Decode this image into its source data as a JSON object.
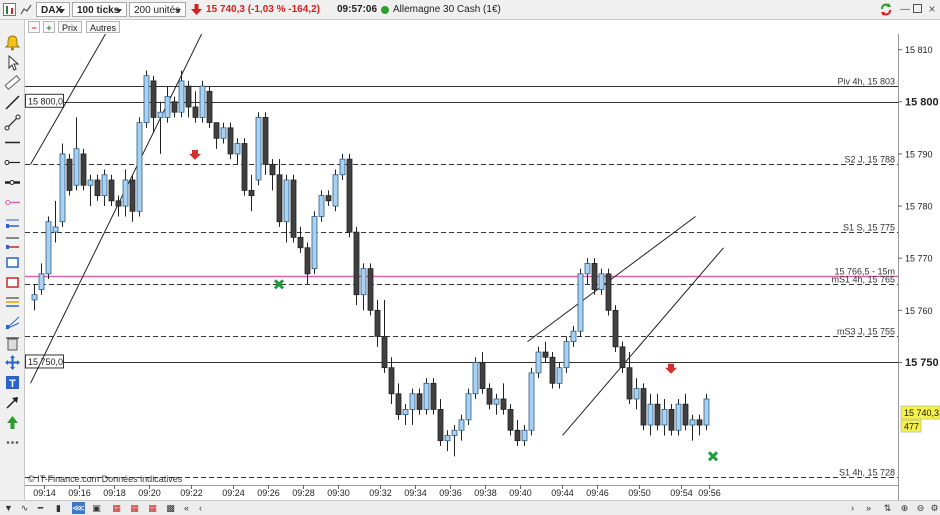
{
  "toolbar": {
    "instrument": "DAX",
    "period": "100 ticks",
    "units": "200 unités",
    "price_text": "15 740,3 (-1,03 % -164,2)",
    "time": "09:57:06",
    "market_name": "Allemagne 30 Cash (1€)",
    "price_color": "#d42020",
    "status_color": "#2aa02a"
  },
  "subbar": {
    "prix": "Prix",
    "autres": "Autres"
  },
  "watermark": "© IT-Finance.com Données indicatives",
  "tools": [
    "alert-bell-icon",
    "pointer-icon",
    "ruler-icon",
    "trendline-icon",
    "segment-icon",
    "horizontal-line-icon",
    "ray-icon",
    "thick-line-icon",
    "pink-line-icon",
    "channel-icon",
    "retracement-icon",
    "box-icon",
    "red-box-icon",
    "fibonacci-icon",
    "fan-icon",
    "trash-icon",
    "move-icon",
    "text-icon",
    "arrow-icon",
    "green-arrow-icon",
    "more-icon"
  ],
  "chart_data": {
    "type": "candlestick",
    "y_range": [
      15726.5,
      15813
    ],
    "y_ticks": [
      {
        "value": 15810,
        "label": "15 810",
        "bold": false
      },
      {
        "value": 15800,
        "label": "15 800",
        "bold": true
      },
      {
        "value": 15790,
        "label": "15 790",
        "bold": false
      },
      {
        "value": 15780,
        "label": "15 780",
        "bold": false
      },
      {
        "value": 15770,
        "label": "15 770",
        "bold": false
      },
      {
        "value": 15760,
        "label": "15 760",
        "bold": false
      },
      {
        "value": 15750,
        "label": "15 750",
        "bold": true
      }
    ],
    "x_ticks": [
      {
        "index": 1.5,
        "label": "09:14"
      },
      {
        "index": 6.5,
        "label": "09:16"
      },
      {
        "index": 11.5,
        "label": "09:18"
      },
      {
        "index": 16.5,
        "label": "09:20"
      },
      {
        "index": 22.5,
        "label": "09:22"
      },
      {
        "index": 28.5,
        "label": "09:24"
      },
      {
        "index": 33.5,
        "label": "09:26"
      },
      {
        "index": 38.5,
        "label": "09:28"
      },
      {
        "index": 43.5,
        "label": "09:30"
      },
      {
        "index": 49.5,
        "label": "09:32"
      },
      {
        "index": 54.5,
        "label": "09:34"
      },
      {
        "index": 59.5,
        "label": "09:36"
      },
      {
        "index": 64.5,
        "label": "09:38"
      },
      {
        "index": 69.5,
        "label": "09:40"
      },
      {
        "index": 75.5,
        "label": "09:44"
      },
      {
        "index": 80.5,
        "label": "09:46"
      },
      {
        "index": 86.5,
        "label": "09:50"
      },
      {
        "index": 92.5,
        "label": "09:54"
      },
      {
        "index": 96.5,
        "label": "09:56"
      }
    ],
    "levels": [
      {
        "value": 15803,
        "label": "Piv 4h, 15 803",
        "style": "solid",
        "color": "#333333"
      },
      {
        "value": 15800,
        "label": "",
        "style": "solid",
        "color": "#333333"
      },
      {
        "value": 15788,
        "label": "S2 J, 15 788",
        "style": "dashed",
        "color": "#333333"
      },
      {
        "value": 15775,
        "label": "S1 S, 15 775",
        "style": "dashed",
        "color": "#333333"
      },
      {
        "value": 15766.5,
        "label": "15 766,5 - 15m",
        "style": "solid",
        "color": "#e060b0"
      },
      {
        "value": 15765,
        "label": "mS1 4h, 15 765",
        "style": "dashed",
        "color": "#333333"
      },
      {
        "value": 15755,
        "label": "mS3 J, 15 755",
        "style": "dashed",
        "color": "#333333"
      },
      {
        "value": 15750,
        "label": "",
        "style": "solid",
        "color": "#333333"
      },
      {
        "value": 15728,
        "label": "S1 4h, 15 728",
        "style": "dashed",
        "color": "#333333"
      }
    ],
    "boxed_labels": [
      {
        "value": 15800,
        "label": "15 800,0"
      },
      {
        "value": 15750,
        "label": "15 750,0"
      }
    ],
    "last_price": {
      "value": 15740.3,
      "label": "15 740,3",
      "volume": "477"
    },
    "candles": [
      [
        15762,
        15765,
        15760,
        15763
      ],
      [
        15764,
        15769,
        15763,
        15767
      ],
      [
        15767,
        15778,
        15766,
        15777
      ],
      [
        15775,
        15781,
        15773,
        15776
      ],
      [
        15777,
        15792,
        15776,
        15790
      ],
      [
        15789,
        15790,
        15782,
        15783
      ],
      [
        15784,
        15797,
        15783,
        15791
      ],
      [
        15790,
        15791,
        15783,
        15784
      ],
      [
        15784,
        15786,
        15780,
        15785
      ],
      [
        15785,
        15786,
        15781,
        15782
      ],
      [
        15782,
        15787,
        15780,
        15786
      ],
      [
        15785,
        15786,
        15780,
        15781
      ],
      [
        15781,
        15782,
        15778,
        15780
      ],
      [
        15780,
        15787,
        15778,
        15785
      ],
      [
        15785,
        15786,
        15777,
        15779
      ],
      [
        15779,
        15797,
        15778,
        15796
      ],
      [
        15796,
        15806,
        15795,
        15805
      ],
      [
        15804,
        15805,
        15794,
        15797
      ],
      [
        15797,
        15800,
        15790,
        15798
      ],
      [
        15797,
        15803,
        15796,
        15801
      ],
      [
        15800,
        15801,
        15797,
        15798
      ],
      [
        15798,
        15806,
        15797,
        15804
      ],
      [
        15803,
        15804,
        15797,
        15799
      ],
      [
        15799,
        15802,
        15796,
        15797
      ],
      [
        15797,
        15804,
        15796,
        15803
      ],
      [
        15802,
        15803,
        15795,
        15796
      ],
      [
        15796,
        15796,
        15791,
        15793
      ],
      [
        15793,
        15796,
        15792,
        15795
      ],
      [
        15795,
        15796,
        15789,
        15790
      ],
      [
        15790,
        15793,
        15788,
        15792
      ],
      [
        15792,
        15793,
        15782,
        15783
      ],
      [
        15783,
        15786,
        15779,
        15782
      ],
      [
        15785,
        15798,
        15784,
        15797
      ],
      [
        15797,
        15798,
        15786,
        15788
      ],
      [
        15788,
        15789,
        15783,
        15786
      ],
      [
        15786,
        15789,
        15776,
        15777
      ],
      [
        15777,
        15786,
        15773,
        15785
      ],
      [
        15785,
        15786,
        15773,
        15774
      ],
      [
        15774,
        15776,
        15771,
        15772
      ],
      [
        15772,
        15773,
        15765,
        15767
      ],
      [
        15768,
        15779,
        15767,
        15778
      ],
      [
        15778,
        15783,
        15777,
        15782
      ],
      [
        15782,
        15783,
        15780,
        15781
      ],
      [
        15780,
        15787,
        15779,
        15786
      ],
      [
        15786,
        15790,
        15785,
        15789
      ],
      [
        15789,
        15790,
        15774,
        15775
      ],
      [
        15775,
        15776,
        15761,
        15763
      ],
      [
        15763,
        15769,
        15760,
        15768
      ],
      [
        15768,
        15769,
        15759,
        15760
      ],
      [
        15760,
        15762,
        15753,
        15755
      ],
      [
        15755,
        15762,
        15748,
        15749
      ],
      [
        15749,
        15751,
        15742,
        15744
      ],
      [
        15744,
        15746,
        15739,
        15740
      ],
      [
        15740,
        15742,
        15738,
        15741
      ],
      [
        15741,
        15745,
        15738,
        15744
      ],
      [
        15744,
        15745,
        15740,
        15741
      ],
      [
        15741,
        15747,
        15740,
        15746
      ],
      [
        15746,
        15747,
        15740,
        15741
      ],
      [
        15741,
        15743,
        15734,
        15735
      ],
      [
        15735,
        15737,
        15733,
        15736
      ],
      [
        15736,
        15738,
        15732,
        15737
      ],
      [
        15737,
        15740,
        15735,
        15739
      ],
      [
        15739,
        15745,
        15738,
        15744
      ],
      [
        15744,
        15751,
        15743,
        15750
      ],
      [
        15750,
        15752,
        15744,
        15745
      ],
      [
        15745,
        15746,
        15741,
        15742
      ],
      [
        15742,
        15744,
        15740,
        15743
      ],
      [
        15743,
        15746,
        15740,
        15741
      ],
      [
        15741,
        15742,
        15736,
        15737
      ],
      [
        15737,
        15739,
        15734,
        15735
      ],
      [
        15735,
        15738,
        15734,
        15737
      ],
      [
        15737,
        15749,
        15736,
        15748
      ],
      [
        15748,
        15753,
        15747,
        15752
      ],
      [
        15752,
        15754,
        15750,
        15751
      ],
      [
        15751,
        15752,
        15745,
        15746
      ],
      [
        15746,
        15750,
        15745,
        15749
      ],
      [
        15749,
        15755,
        15748,
        15754
      ],
      [
        15754,
        15757,
        15753,
        15756
      ],
      [
        15756,
        15768,
        15755,
        15767
      ],
      [
        15767,
        15770,
        15765,
        15769
      ],
      [
        15769,
        15770,
        15763,
        15764
      ],
      [
        15764,
        15768,
        15763,
        15767
      ],
      [
        15767,
        15768,
        15759,
        15760
      ],
      [
        15760,
        15761,
        15752,
        15753
      ],
      [
        15753,
        15754,
        15748,
        15749
      ],
      [
        15749,
        15752,
        15742,
        15743
      ],
      [
        15743,
        15747,
        15741,
        15745
      ],
      [
        15745,
        15746,
        15737,
        15738
      ],
      [
        15738,
        15744,
        15736,
        15742
      ],
      [
        15742,
        15744,
        15737,
        15738
      ],
      [
        15738,
        15743,
        15736,
        15741
      ],
      [
        15741,
        15742,
        15736,
        15737
      ],
      [
        15737,
        15743,
        15736,
        15742
      ],
      [
        15742,
        15744,
        15737,
        15738
      ],
      [
        15738,
        15740,
        15735,
        15739
      ],
      [
        15739,
        15740,
        15736,
        15738
      ],
      [
        15738,
        15744,
        15737,
        15743
      ]
    ],
    "trendlines": [
      {
        "from": [
          -0.5,
          15788
        ],
        "to": [
          11.5,
          15816
        ]
      },
      {
        "from": [
          -0.5,
          15746
        ],
        "to": [
          26.5,
          15820
        ]
      },
      {
        "from": [
          70.5,
          15754
        ],
        "to": [
          94.5,
          15778
        ]
      },
      {
        "from": [
          75.5,
          15736
        ],
        "to": [
          98.5,
          15772
        ]
      }
    ],
    "signals": [
      {
        "index": 23,
        "value": 15790,
        "type": "sell"
      },
      {
        "index": 35,
        "value": 15765,
        "type": "buy"
      },
      {
        "index": 91,
        "value": 15749,
        "type": "sell"
      },
      {
        "index": 97,
        "value": 15732,
        "type": "buy"
      }
    ]
  }
}
